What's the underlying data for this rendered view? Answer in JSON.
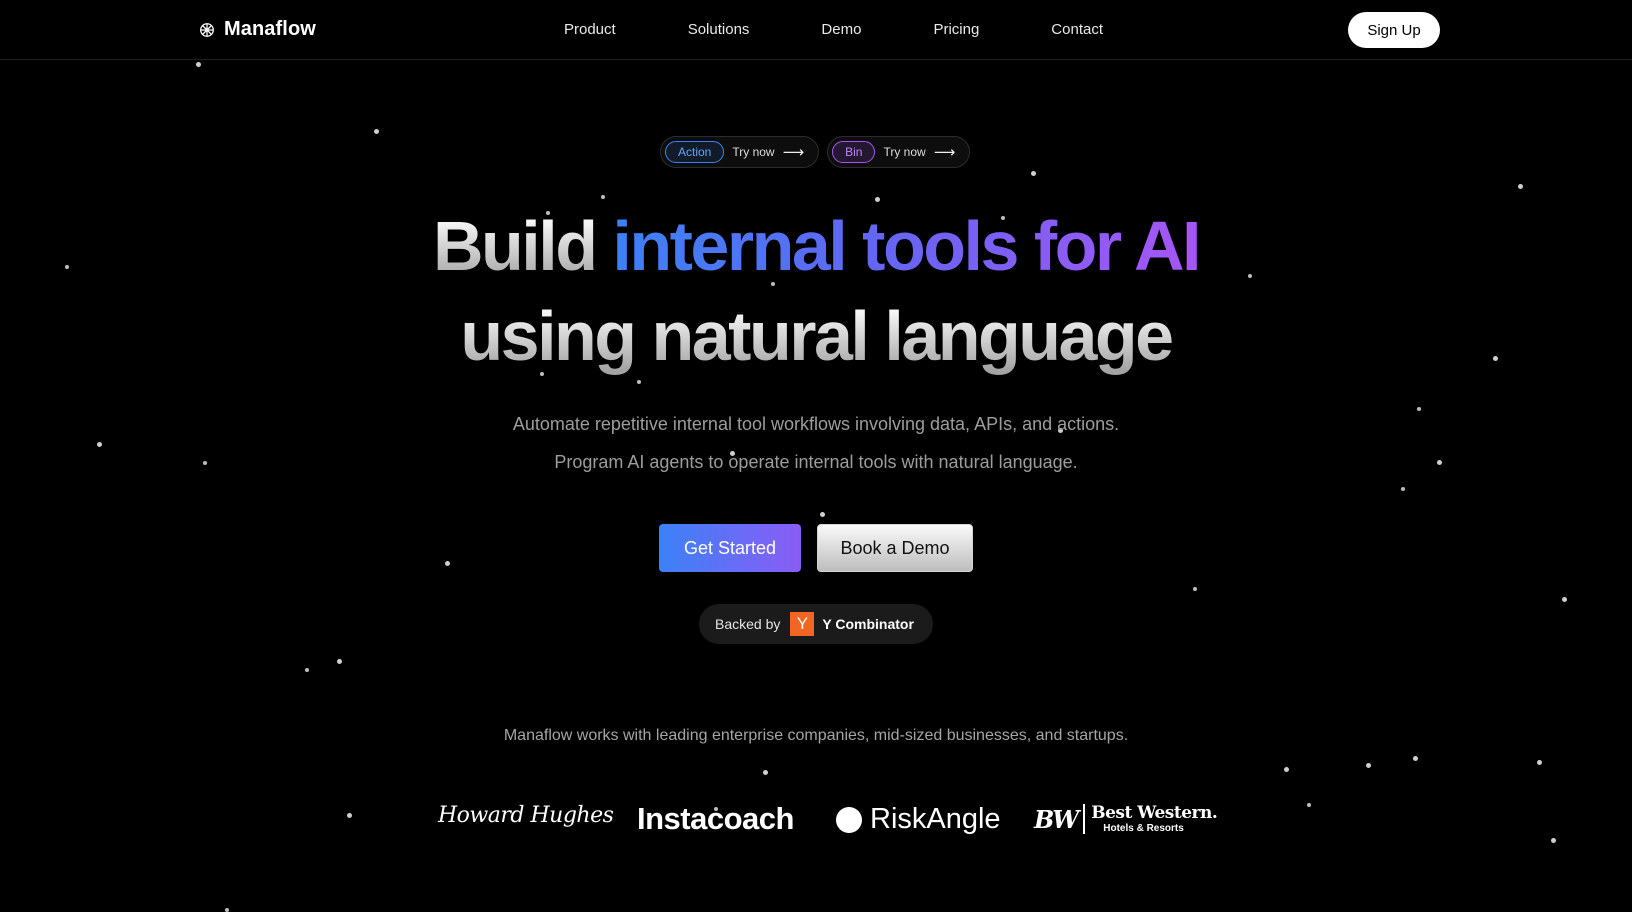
{
  "brand": {
    "name": "Manaflow",
    "icon": "brain-icon"
  },
  "nav": {
    "links": [
      "Product",
      "Solutions",
      "Demo",
      "Pricing",
      "Contact"
    ],
    "signup_label": "Sign Up"
  },
  "pills": [
    {
      "tag": "Action",
      "text": "Try now",
      "color": "#3b82f6"
    },
    {
      "tag": "Bin",
      "text": "Try now",
      "color": "#a855f7"
    }
  ],
  "headline": {
    "line1_plain": "Build ",
    "line1_highlight": "internal tools for AI",
    "line2": "using natural language"
  },
  "subtitle": {
    "line1": "Automate repetitive internal tool workflows involving data, APIs, and actions.",
    "line2": "Program AI agents to operate internal tools with natural language."
  },
  "cta": {
    "primary_label": "Get Started",
    "secondary_label": "Book a Demo"
  },
  "backed": {
    "prefix": "Backed by",
    "logo_letter": "Y",
    "name": "Y Combinator",
    "logo_color": "#f26522"
  },
  "customers": {
    "intro": "Manaflow works with leading enterprise companies, mid-sized businesses, and startups.",
    "logos": {
      "howard_hughes": "Howard Hughes",
      "instacoach": "Instacoach",
      "riskangle": "RiskAngle",
      "bw_mark": "BW",
      "bw_title": "Best Western.",
      "bw_sub": "Hotels & Resorts"
    }
  },
  "colors": {
    "background": "#000000",
    "accent_blue": "#3b82f6",
    "accent_purple": "#a855f7"
  }
}
